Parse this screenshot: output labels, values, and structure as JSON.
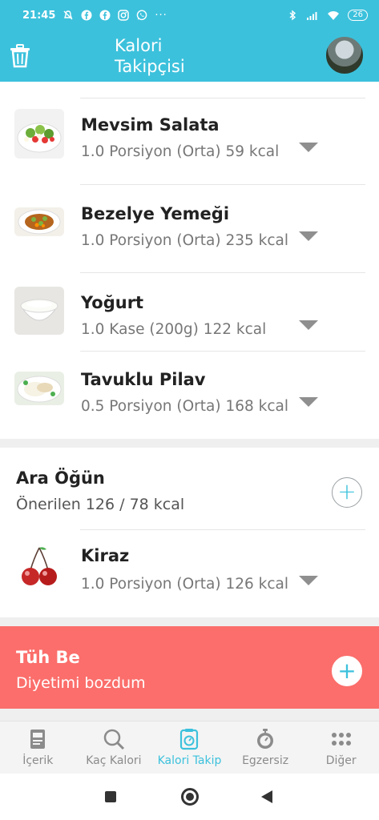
{
  "status_bar": {
    "time": "21:45",
    "battery": "26",
    "icons": [
      "mute-icon",
      "facebook-icon",
      "facebook-icon",
      "instagram-icon",
      "whatsapp-icon",
      "more-icon",
      "bluetooth-icon",
      "signal-icon",
      "wifi-icon",
      "battery-icon"
    ],
    "more": "···"
  },
  "app_bar": {
    "title": "Kalori\nTakipçisi",
    "accent_color": "#3cc1dc"
  },
  "foods": [
    {
      "name": "Mevsim Salata",
      "detail": "1.0 Porsiyon (Orta) 59 kcal",
      "image": "salad-image"
    },
    {
      "name": "Bezelye Yemeği",
      "detail": "1.0 Porsiyon (Orta) 235 kcal",
      "image": "peas-dish-image"
    },
    {
      "name": "Yoğurt",
      "detail": "1.0 Kase (200g) 122 kcal",
      "image": "yogurt-image"
    },
    {
      "name": "Tavuklu Pilav",
      "detail": "0.5 Porsiyon (Orta) 168 kcal",
      "image": "chicken-rice-image"
    }
  ],
  "snack": {
    "title": "Ara Öğün",
    "subtitle": "Önerilen 126 / 78 kcal",
    "add": "+"
  },
  "snack_foods": [
    {
      "name": "Kiraz",
      "detail": "1.0 Porsiyon (Orta) 126 kcal",
      "image": "cherry-image"
    }
  ],
  "tuh_be": {
    "title": "Tüh Be",
    "subtitle": "Diyetimi bozdum",
    "add": "+",
    "color": "#fb6e6b"
  },
  "bottom_nav": [
    {
      "label": "İçerik",
      "icon": "content-icon",
      "active": false
    },
    {
      "label": "Kaç Kalori",
      "icon": "search-icon",
      "active": false
    },
    {
      "label": "Kalori Takip",
      "icon": "scale-icon",
      "active": true
    },
    {
      "label": "Egzersiz",
      "icon": "stopwatch-icon",
      "active": false
    },
    {
      "label": "Diğer",
      "icon": "grid-icon",
      "active": false
    }
  ]
}
